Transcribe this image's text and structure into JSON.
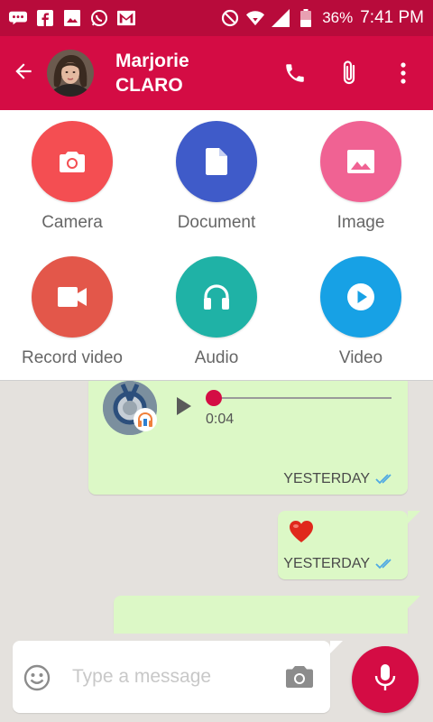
{
  "status_bar": {
    "battery_percent": "36%",
    "time": "7:41 PM",
    "icons": [
      "chat-bubble-icon",
      "facebook-icon",
      "gallery-icon",
      "whatsapp-icon",
      "gmail-icon",
      "do-not-disturb-icon",
      "wifi-icon",
      "signal-icon",
      "battery-icon"
    ]
  },
  "header": {
    "contact_first": "Marjorie",
    "contact_last": "CLARO",
    "icons": [
      "back-arrow-icon",
      "phone-icon",
      "paperclip-icon",
      "more-vert-icon"
    ],
    "colors": {
      "status_bar": "#b80b3b",
      "app_bar": "#d40c44"
    }
  },
  "attach_menu": {
    "items": [
      {
        "label": "Camera",
        "icon": "camera-icon",
        "color": "#f44e52"
      },
      {
        "label": "Document",
        "icon": "document-icon",
        "color": "#3f5bc9"
      },
      {
        "label": "Image",
        "icon": "image-icon",
        "color": "#f06293"
      },
      {
        "label": "Record video",
        "icon": "video-camera-icon",
        "color": "#e3574a"
      },
      {
        "label": "Audio",
        "icon": "headphones-icon",
        "color": "#1fb2a6"
      },
      {
        "label": "Video",
        "icon": "play-circle-icon",
        "color": "#17a1e5"
      }
    ]
  },
  "messages": [
    {
      "type": "audio",
      "duration": "0:04",
      "progress": 0,
      "time": "YESTERDAY",
      "status": "read"
    },
    {
      "type": "emoji",
      "content": "heart",
      "time": "YESTERDAY",
      "status": "read"
    },
    {
      "type": "text",
      "content": ""
    }
  ],
  "composer": {
    "placeholder": "Type a message",
    "value": ""
  }
}
